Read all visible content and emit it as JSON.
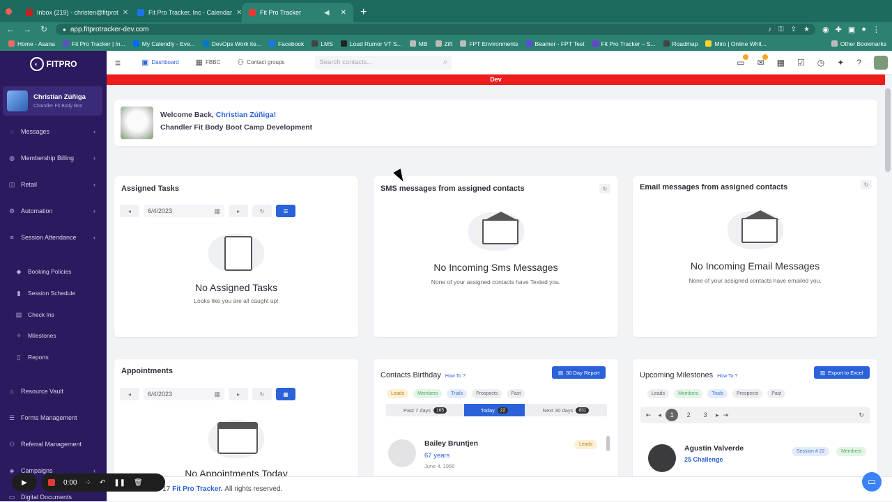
{
  "browser": {
    "tabs": [
      {
        "label": "Inbox (219) - christen@fitprot",
        "color": "#c5221f",
        "active": false
      },
      {
        "label": "Fit Pro Tracker, Inc - Calendar",
        "color": "#1a73e8",
        "active": false
      },
      {
        "label": "Fit Pro Tracker",
        "color": "#e53935",
        "active": true
      }
    ],
    "url": "app.fitprotracker-dev.com",
    "bookmarks": [
      {
        "label": "Home - Asana",
        "color": "#f06a6a"
      },
      {
        "label": "Fit Pro Tracker | In...",
        "color": "#5a4fcf"
      },
      {
        "label": "My Calendly - Eve...",
        "color": "#006bff"
      },
      {
        "label": "DevOps Work ite...",
        "color": "#0078d4"
      },
      {
        "label": "Facebook",
        "color": "#1877f2"
      },
      {
        "label": "LMS",
        "color": "#444444"
      },
      {
        "label": "Loud Rumor VT S...",
        "color": "#222222"
      },
      {
        "label": "MB",
        "color": "#888888"
      },
      {
        "label": "Zift",
        "color": "#888888"
      },
      {
        "label": "FPT Environments",
        "color": "#888888"
      },
      {
        "label": "Beamer - FPT Test",
        "color": "#5b4cdb"
      },
      {
        "label": "Fit Pro Tracker – S...",
        "color": "#6a3fd6"
      },
      {
        "label": "Roadmap",
        "color": "#444444"
      },
      {
        "label": "Miro | Online Whit...",
        "color": "#ffd02f"
      }
    ],
    "other_bookmarks": "Other Bookmarks"
  },
  "sidebar": {
    "logo_text": "FITPRO",
    "user_name": "Christian Zúñiga",
    "user_sub": "Chandler Fit Body Boo",
    "items": [
      {
        "label": "Messages",
        "icon": "chat-icon",
        "chevron": true
      },
      {
        "label": "Membership Billing",
        "icon": "billing-icon",
        "chevron": true
      },
      {
        "label": "Retail",
        "icon": "retail-icon",
        "chevron": true
      },
      {
        "label": "Automation",
        "icon": "automation-icon",
        "chevron": true
      },
      {
        "label": "Session Attendance",
        "icon": "attendance-icon",
        "chevron": true
      }
    ],
    "subitems": [
      {
        "label": "Booking Policies",
        "icon": "policy-icon"
      },
      {
        "label": "Session Schedule",
        "icon": "schedule-icon"
      },
      {
        "label": "Check Ins",
        "icon": "checkin-icon"
      },
      {
        "label": "Milestones",
        "icon": "milestone-icon"
      },
      {
        "label": "Reports",
        "icon": "reports-icon"
      }
    ],
    "items2": [
      {
        "label": "Resource Vault",
        "icon": "vault-icon"
      },
      {
        "label": "Forms Management",
        "icon": "forms-icon"
      },
      {
        "label": "Referral Management",
        "icon": "referral-icon"
      },
      {
        "label": "Campaigns",
        "icon": "campaign-icon"
      },
      {
        "label": "Digital Documents",
        "icon": "documents-icon"
      }
    ]
  },
  "header": {
    "tabs": [
      {
        "label": "Dashboard",
        "active": true
      },
      {
        "label": "FBBC",
        "active": false
      },
      {
        "label": "Contact groups",
        "active": false
      }
    ],
    "search_placeholder": "Search contacts..."
  },
  "env_banner": "Dev",
  "welcome": {
    "prefix": "Welcome Back,",
    "name": "Christian Zúñiga!",
    "location": "Chandler Fit Body Boot Camp Development"
  },
  "assigned_tasks": {
    "title": "Assigned Tasks",
    "date": "6/4/2023",
    "empty_title": "No Assigned Tasks",
    "empty_sub": "Looks like you are all caught up!"
  },
  "sms": {
    "title": "SMS messages from assigned contacts",
    "empty_title": "No Incoming Sms Messages",
    "empty_sub": "None of your assigned contacts have Texted you."
  },
  "email": {
    "title": "Email messages from assigned contacts",
    "empty_title": "No Incoming Email Messages",
    "empty_sub": "None of your assigned contacts have emailed you."
  },
  "appointments": {
    "title": "Appointments",
    "date": "6/4/2023",
    "empty_title": "No Appointments Today"
  },
  "birthdays": {
    "title": "Contacts Birthday",
    "how_to": "How To",
    "report_button": "30 Day Report",
    "filters": [
      "Leads",
      "Members",
      "Trials",
      "Prospects",
      "Past"
    ],
    "ranges": [
      {
        "label": "Past 7 days",
        "count": "165",
        "active": false
      },
      {
        "label": "Today",
        "count": "22",
        "active": true
      },
      {
        "label": "Next 30 days",
        "count": "831",
        "active": false
      }
    ],
    "person": {
      "name": "Bailey Bruntjen",
      "age": "67 years",
      "date": "June 4, 1956",
      "tag": "Leads"
    }
  },
  "milestones": {
    "title": "Upcoming Milestones",
    "how_to": "How To",
    "export_button": "Export to Excel",
    "filters": [
      "Leads",
      "Members",
      "Trials",
      "Prospects",
      "Past"
    ],
    "pages": [
      "1",
      "2",
      "3"
    ],
    "person": {
      "name": "Agustin Valverde",
      "challenge": "25 Challenge",
      "session": "Session # 22",
      "tag": "Members"
    }
  },
  "footer": {
    "prefix": "17",
    "brand": "Fit Pro Tracker.",
    "suffix": "All rights reserved."
  },
  "recorder": {
    "time": "0:00"
  }
}
